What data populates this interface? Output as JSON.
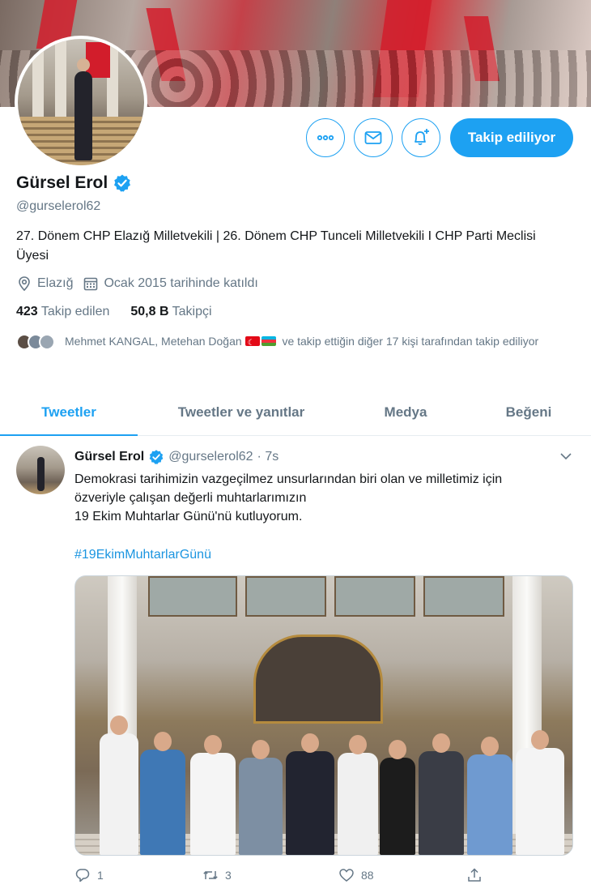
{
  "profile": {
    "name": "Gürsel Erol",
    "handle": "@gurselerol62",
    "bio": "27. Dönem CHP Elazığ Milletvekili | 26. Dönem CHP Tunceli Milletvekili I CHP Parti Meclisi Üyesi",
    "location": "Elazığ",
    "joined": "Ocak 2015 tarihinde katıldı",
    "following_count": "423",
    "following_label": "Takip edilen",
    "followers_count": "50,8 B",
    "followers_label": "Takipçi",
    "followed_by_names": "Mehmet KANGAL, Metehan Doğan",
    "followed_by_rest": "ve takip ettiğin diğer 17 kişi tarafından takip ediliyor",
    "follow_button": "Takip ediliyor"
  },
  "tabs": [
    "Tweetler",
    "Tweetler ve yanıtlar",
    "Medya",
    "Beğeni"
  ],
  "active_tab": "Tweetler",
  "tweet": {
    "name": "Gürsel Erol",
    "handle": "@gurselerol62",
    "time": "· 7s",
    "line1": "Demokrasi tarihimizin vazgeçilmez unsurlarından biri olan ve milletimiz için",
    "line2": "özveriyle çalışan değerli muhtarlarımızın",
    "line3": "19 Ekim Muhtarlar Günü'nü kutluyorum.",
    "hashtag": "#19EkimMuhtarlarGünü",
    "reply_count": "1",
    "retweet_count": "3",
    "like_count": "88"
  },
  "icons": {
    "more": "more-icon",
    "message": "envelope-icon",
    "notify": "bell-plus-icon",
    "verified": "verified-badge-icon",
    "location": "location-pin-icon",
    "calendar": "calendar-icon",
    "caret": "chevron-down-icon",
    "reply": "reply-icon",
    "retweet": "retweet-icon",
    "like": "heart-icon",
    "share": "share-icon"
  },
  "colors": {
    "accent": "#1da1f2",
    "secondary_text": "#657786",
    "primary_text": "#14171a",
    "border": "#e6ecf0"
  }
}
